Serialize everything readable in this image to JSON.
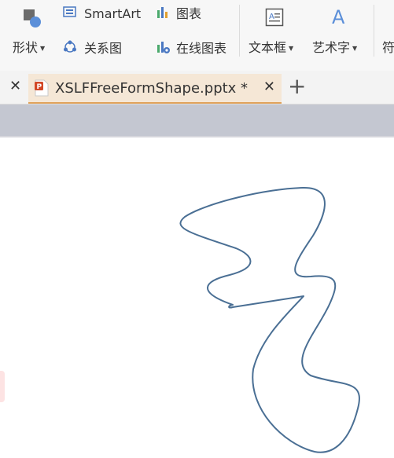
{
  "ribbon": {
    "shapes_label": "形状",
    "smartart_label": "SmartArt",
    "chart_label": "图表",
    "relationship_label": "关系图",
    "online_chart_label": "在线图表",
    "textbox_label": "文本框",
    "wordart_label": "艺术字",
    "symbol_label": "符"
  },
  "tabs": {
    "active_title": "XSLFFreeFormShape.pptx *"
  },
  "colors": {
    "freeform_stroke": "#4a6f94",
    "tab_active_bg": "#f5e7d6",
    "tab_accent": "#e0a25a",
    "ppt_icon": "#d24726"
  }
}
